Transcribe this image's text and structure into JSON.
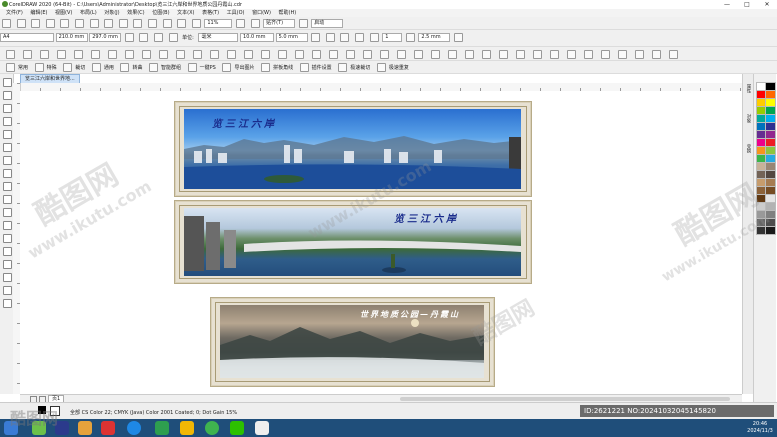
{
  "window": {
    "title": "CorelDRAW 2020 (64-Bit) - C:\\Users\\Administrator\\Desktop\\览三江六岸和世界地质公园丹霞山.cdr",
    "controls": [
      "—",
      "□",
      "✕"
    ]
  },
  "menu": [
    "文件(F)",
    "编辑(E)",
    "视图(V)",
    "布局(L)",
    "对象(J)",
    "效果(C)",
    "位图(B)",
    "文本(X)",
    "表格(T)",
    "工具(O)",
    "窗口(W)",
    "帮助(H)"
  ],
  "standard_toolbar": {
    "zoom": "11%",
    "snap": "贴齐(T)",
    "launch": "启动"
  },
  "property_bar": {
    "page_size": "A4",
    "width": "210.0 mm",
    "height": "297.0 mm",
    "unit_label": "单位:",
    "unit": "毫米",
    "nudge": "10.0 mm",
    "dup_x": "5.0 mm",
    "dup_y": "5.0 mm",
    "page_num": "1",
    "bleed": "2.5 mm"
  },
  "plugin_toolbar": [
    "常用",
    "特殊",
    "裁切",
    "通用",
    "转曲",
    "智能群组",
    "一键PS",
    "导出图片",
    "拼板角线",
    "插件设置",
    "极速裁切",
    "极速重复"
  ],
  "doc_tab": "览三江六岸和世界地...",
  "panels": [
    {
      "caption": "览三江六岸",
      "caption_color": "#1a2c8c"
    },
    {
      "caption": "览三江六岸",
      "caption_color": "#1a2c8c"
    },
    {
      "caption": "世界地质公园—丹霞山",
      "caption_color": "#ffffff"
    }
  ],
  "page_tab": "页1",
  "status": "全部 CS Color 22; CMYK (Java) Color 2001 Coated; 0; Dot Gain 15%",
  "watermarks": {
    "brand_cn": "酷图网",
    "brand_url": "www.ikutu.com",
    "id_text": "ID:2621221 NO:20241032045145820"
  },
  "clock": {
    "time": "20:46",
    "date": "2024/11/3"
  },
  "side_tabs": [
    "属性",
    "对象",
    "变换"
  ],
  "colors": {
    "frame": "#e7e1d2",
    "taskbar": "#1f4e7a",
    "swatches": [
      "#ffffff",
      "#000000",
      "#ff0000",
      "#ff6600",
      "#ffcc00",
      "#ffff00",
      "#99cc00",
      "#00a651",
      "#00a99d",
      "#00aeef",
      "#0072bc",
      "#2e3192",
      "#662d91",
      "#92278f",
      "#ec008c",
      "#ed1c24",
      "#f7941d",
      "#8dc63f",
      "#39b54a",
      "#27aae1",
      "#c7b299",
      "#998675",
      "#736357",
      "#534741",
      "#c69c6d",
      "#a67c52",
      "#8c6239",
      "#754c24",
      "#603913",
      "#e5e5e5",
      "#cccccc",
      "#b3b3b3",
      "#999999",
      "#808080",
      "#666666",
      "#4d4d4d",
      "#333333",
      "#1a1a1a"
    ]
  }
}
